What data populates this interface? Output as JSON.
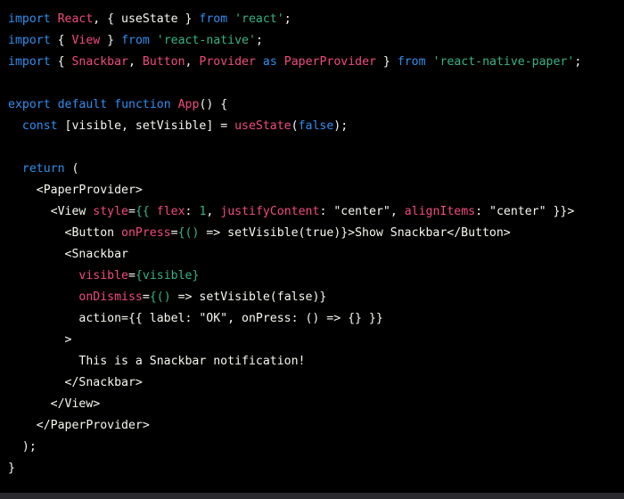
{
  "colors": {
    "background": "#000000",
    "default_text": "#f8f8f2",
    "keyword": "#2f8ff0",
    "identifier": "#f14a82",
    "string": "#36b389",
    "bottom_strip": "#2a2a2e"
  },
  "code": {
    "language": "jsx",
    "lines": [
      [
        {
          "t": "import",
          "c": "blue"
        },
        {
          "t": " ",
          "c": "white"
        },
        {
          "t": "React",
          "c": "pink"
        },
        {
          "t": ", { useState } ",
          "c": "white"
        },
        {
          "t": "from",
          "c": "blue"
        },
        {
          "t": " ",
          "c": "white"
        },
        {
          "t": "'react'",
          "c": "green"
        },
        {
          "t": ";",
          "c": "white"
        }
      ],
      [
        {
          "t": "import",
          "c": "blue"
        },
        {
          "t": " { ",
          "c": "white"
        },
        {
          "t": "View",
          "c": "pink"
        },
        {
          "t": " } ",
          "c": "white"
        },
        {
          "t": "from",
          "c": "blue"
        },
        {
          "t": " ",
          "c": "white"
        },
        {
          "t": "'react-native'",
          "c": "green"
        },
        {
          "t": ";",
          "c": "white"
        }
      ],
      [
        {
          "t": "import",
          "c": "blue"
        },
        {
          "t": " { ",
          "c": "white"
        },
        {
          "t": "Snackbar",
          "c": "pink"
        },
        {
          "t": ", ",
          "c": "white"
        },
        {
          "t": "Button",
          "c": "pink"
        },
        {
          "t": ", ",
          "c": "white"
        },
        {
          "t": "Provider",
          "c": "pink"
        },
        {
          "t": " ",
          "c": "white"
        },
        {
          "t": "as",
          "c": "blue"
        },
        {
          "t": " ",
          "c": "white"
        },
        {
          "t": "PaperProvider",
          "c": "pink"
        },
        {
          "t": " } ",
          "c": "white"
        },
        {
          "t": "from",
          "c": "blue"
        },
        {
          "t": " ",
          "c": "white"
        },
        {
          "t": "'react-native-paper'",
          "c": "green"
        },
        {
          "t": ";",
          "c": "white"
        }
      ],
      [],
      [
        {
          "t": "export",
          "c": "blue"
        },
        {
          "t": " ",
          "c": "white"
        },
        {
          "t": "default",
          "c": "blue"
        },
        {
          "t": " ",
          "c": "white"
        },
        {
          "t": "function",
          "c": "blue"
        },
        {
          "t": " ",
          "c": "white"
        },
        {
          "t": "App",
          "c": "pink"
        },
        {
          "t": "() {",
          "c": "white"
        }
      ],
      [
        {
          "t": "  ",
          "c": "white"
        },
        {
          "t": "const",
          "c": "blue"
        },
        {
          "t": " [visible, setVisible] = ",
          "c": "white"
        },
        {
          "t": "useState",
          "c": "pink"
        },
        {
          "t": "(",
          "c": "white"
        },
        {
          "t": "false",
          "c": "blue"
        },
        {
          "t": ");",
          "c": "white"
        }
      ],
      [],
      [
        {
          "t": "  ",
          "c": "white"
        },
        {
          "t": "return",
          "c": "blue"
        },
        {
          "t": " (",
          "c": "white"
        }
      ],
      [
        {
          "t": "    <PaperProvider>",
          "c": "white"
        }
      ],
      [
        {
          "t": "      <View ",
          "c": "white"
        },
        {
          "t": "style",
          "c": "pink"
        },
        {
          "t": "=",
          "c": "white"
        },
        {
          "t": "{{",
          "c": "green"
        },
        {
          "t": " ",
          "c": "white"
        },
        {
          "t": "flex",
          "c": "pink"
        },
        {
          "t": ": ",
          "c": "white"
        },
        {
          "t": "1",
          "c": "green"
        },
        {
          "t": ", ",
          "c": "white"
        },
        {
          "t": "justifyContent",
          "c": "pink"
        },
        {
          "t": ": \"center\", ",
          "c": "white"
        },
        {
          "t": "alignItems",
          "c": "pink"
        },
        {
          "t": ": \"center\" }}>",
          "c": "white"
        }
      ],
      [
        {
          "t": "        <Button ",
          "c": "white"
        },
        {
          "t": "onPress",
          "c": "pink"
        },
        {
          "t": "=",
          "c": "white"
        },
        {
          "t": "{()",
          "c": "green"
        },
        {
          "t": " => setVisible(true)}>Show Snackbar</Button>",
          "c": "white"
        }
      ],
      [
        {
          "t": "        <Snackbar",
          "c": "white"
        }
      ],
      [
        {
          "t": "          ",
          "c": "white"
        },
        {
          "t": "visible",
          "c": "pink"
        },
        {
          "t": "=",
          "c": "white"
        },
        {
          "t": "{visible}",
          "c": "green"
        }
      ],
      [
        {
          "t": "          ",
          "c": "white"
        },
        {
          "t": "onDismiss",
          "c": "pink"
        },
        {
          "t": "=",
          "c": "white"
        },
        {
          "t": "{()",
          "c": "green"
        },
        {
          "t": " => setVisible(false)}",
          "c": "white"
        }
      ],
      [
        {
          "t": "          action={{ label: \"OK\", onPress: () => {} }}",
          "c": "white"
        }
      ],
      [
        {
          "t": "        >",
          "c": "white"
        }
      ],
      [
        {
          "t": "          This is a Snackbar notification!",
          "c": "white"
        }
      ],
      [
        {
          "t": "        </Snackbar>",
          "c": "white"
        }
      ],
      [
        {
          "t": "      </View>",
          "c": "white"
        }
      ],
      [
        {
          "t": "    </PaperProvider>",
          "c": "white"
        }
      ],
      [
        {
          "t": "  );",
          "c": "white"
        }
      ],
      [
        {
          "t": "}",
          "c": "white"
        }
      ]
    ]
  }
}
